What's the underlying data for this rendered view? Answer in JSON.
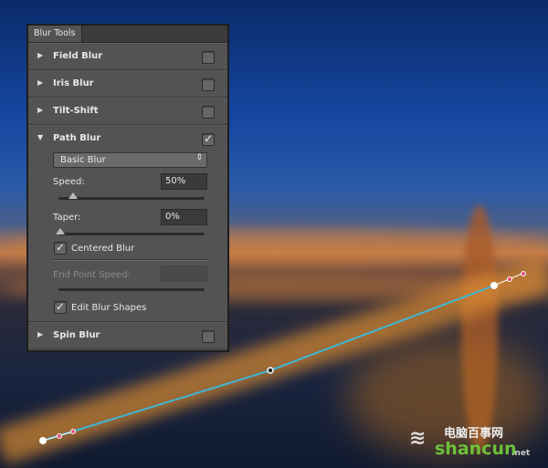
{
  "panel": {
    "tab": "Blur Tools",
    "sections": [
      {
        "label": "Field Blur",
        "checked": false
      },
      {
        "label": "Iris Blur",
        "checked": false
      },
      {
        "label": "Tilt-Shift",
        "checked": false
      },
      {
        "label": "Path Blur",
        "checked": true
      },
      {
        "label": "Spin Blur",
        "checked": false
      }
    ],
    "path_blur": {
      "mode": "Basic Blur",
      "speed_label": "Speed:",
      "speed_value": "50%",
      "speed": 50,
      "taper_label": "Taper:",
      "taper_value": "0%",
      "taper": 0,
      "centered_blur_label": "Centered Blur",
      "centered_blur": true,
      "end_point_speed_label": "End Point Speed:",
      "edit_blur_shapes_label": "Edit Blur Shapes",
      "edit_blur_shapes": true
    }
  },
  "watermark": {
    "text": "电脑百事网",
    "latin": "shancun",
    ".net": ".net"
  },
  "colors": {
    "path_line": "#3fb6d6",
    "handle": "#ffffff",
    "endpoint_marker": "#e0507a"
  }
}
